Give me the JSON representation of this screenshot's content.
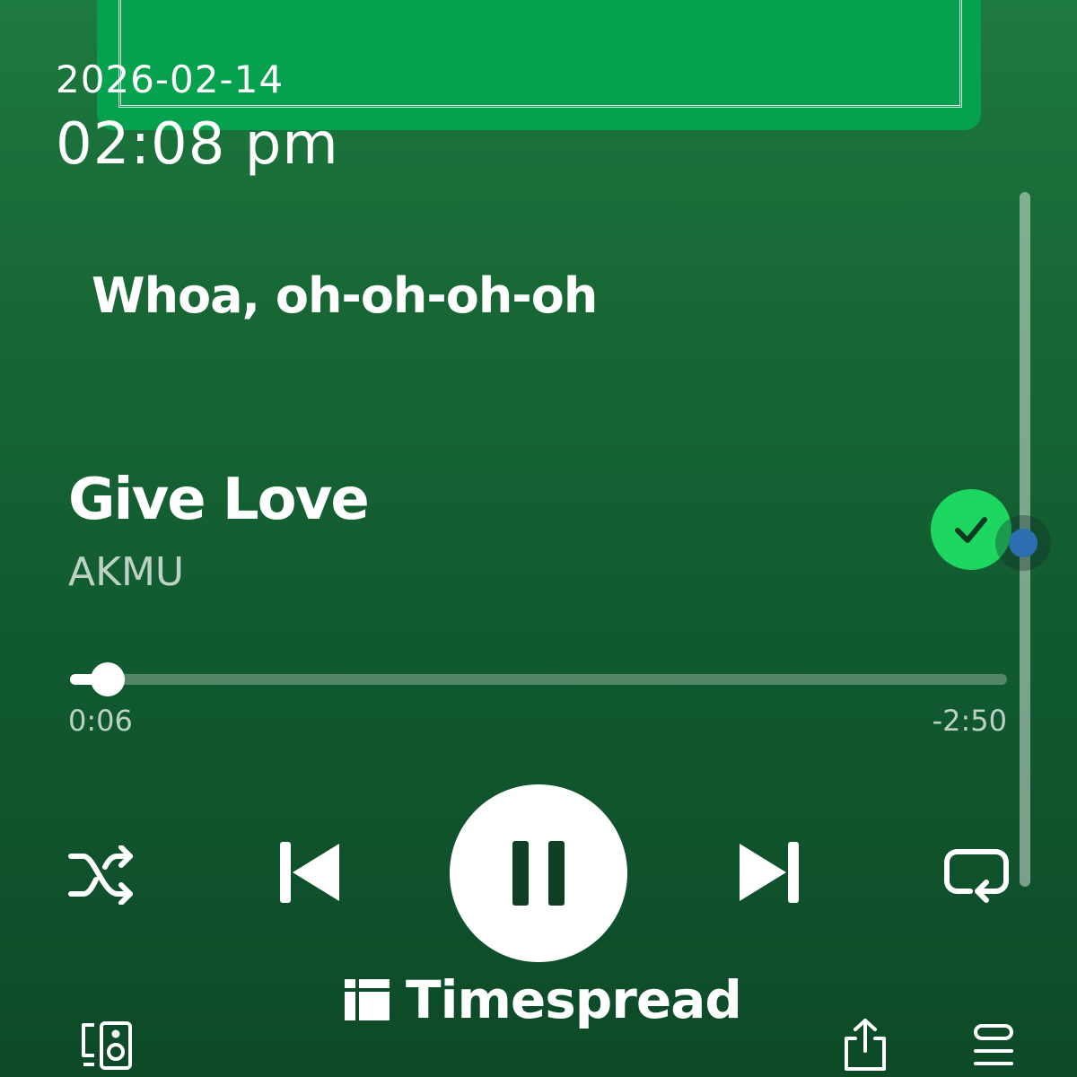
{
  "status": {
    "date": "2026-02-14",
    "time": "02:08 pm"
  },
  "lyrics": {
    "current_line": "Whoa, oh-oh-oh-oh"
  },
  "track": {
    "title": "Give Love",
    "artist": "AKMU",
    "saved": true
  },
  "playback": {
    "elapsed": "0:06",
    "remaining": "-2:50",
    "progress_fraction": 0.04,
    "state": "playing"
  },
  "controls": {
    "shuffle_icon": "shuffle-icon",
    "previous_icon": "skip-previous-icon",
    "pause_icon": "pause-icon",
    "next_icon": "skip-next-icon",
    "repeat_icon": "repeat-icon"
  },
  "footer": {
    "watermark": "Timespread",
    "devices_icon": "connect-device-icon",
    "share_icon": "share-icon",
    "queue_icon": "queue-icon"
  },
  "colors": {
    "accent": "#1ed760",
    "background": "#115a30",
    "art": "#06a14e"
  }
}
